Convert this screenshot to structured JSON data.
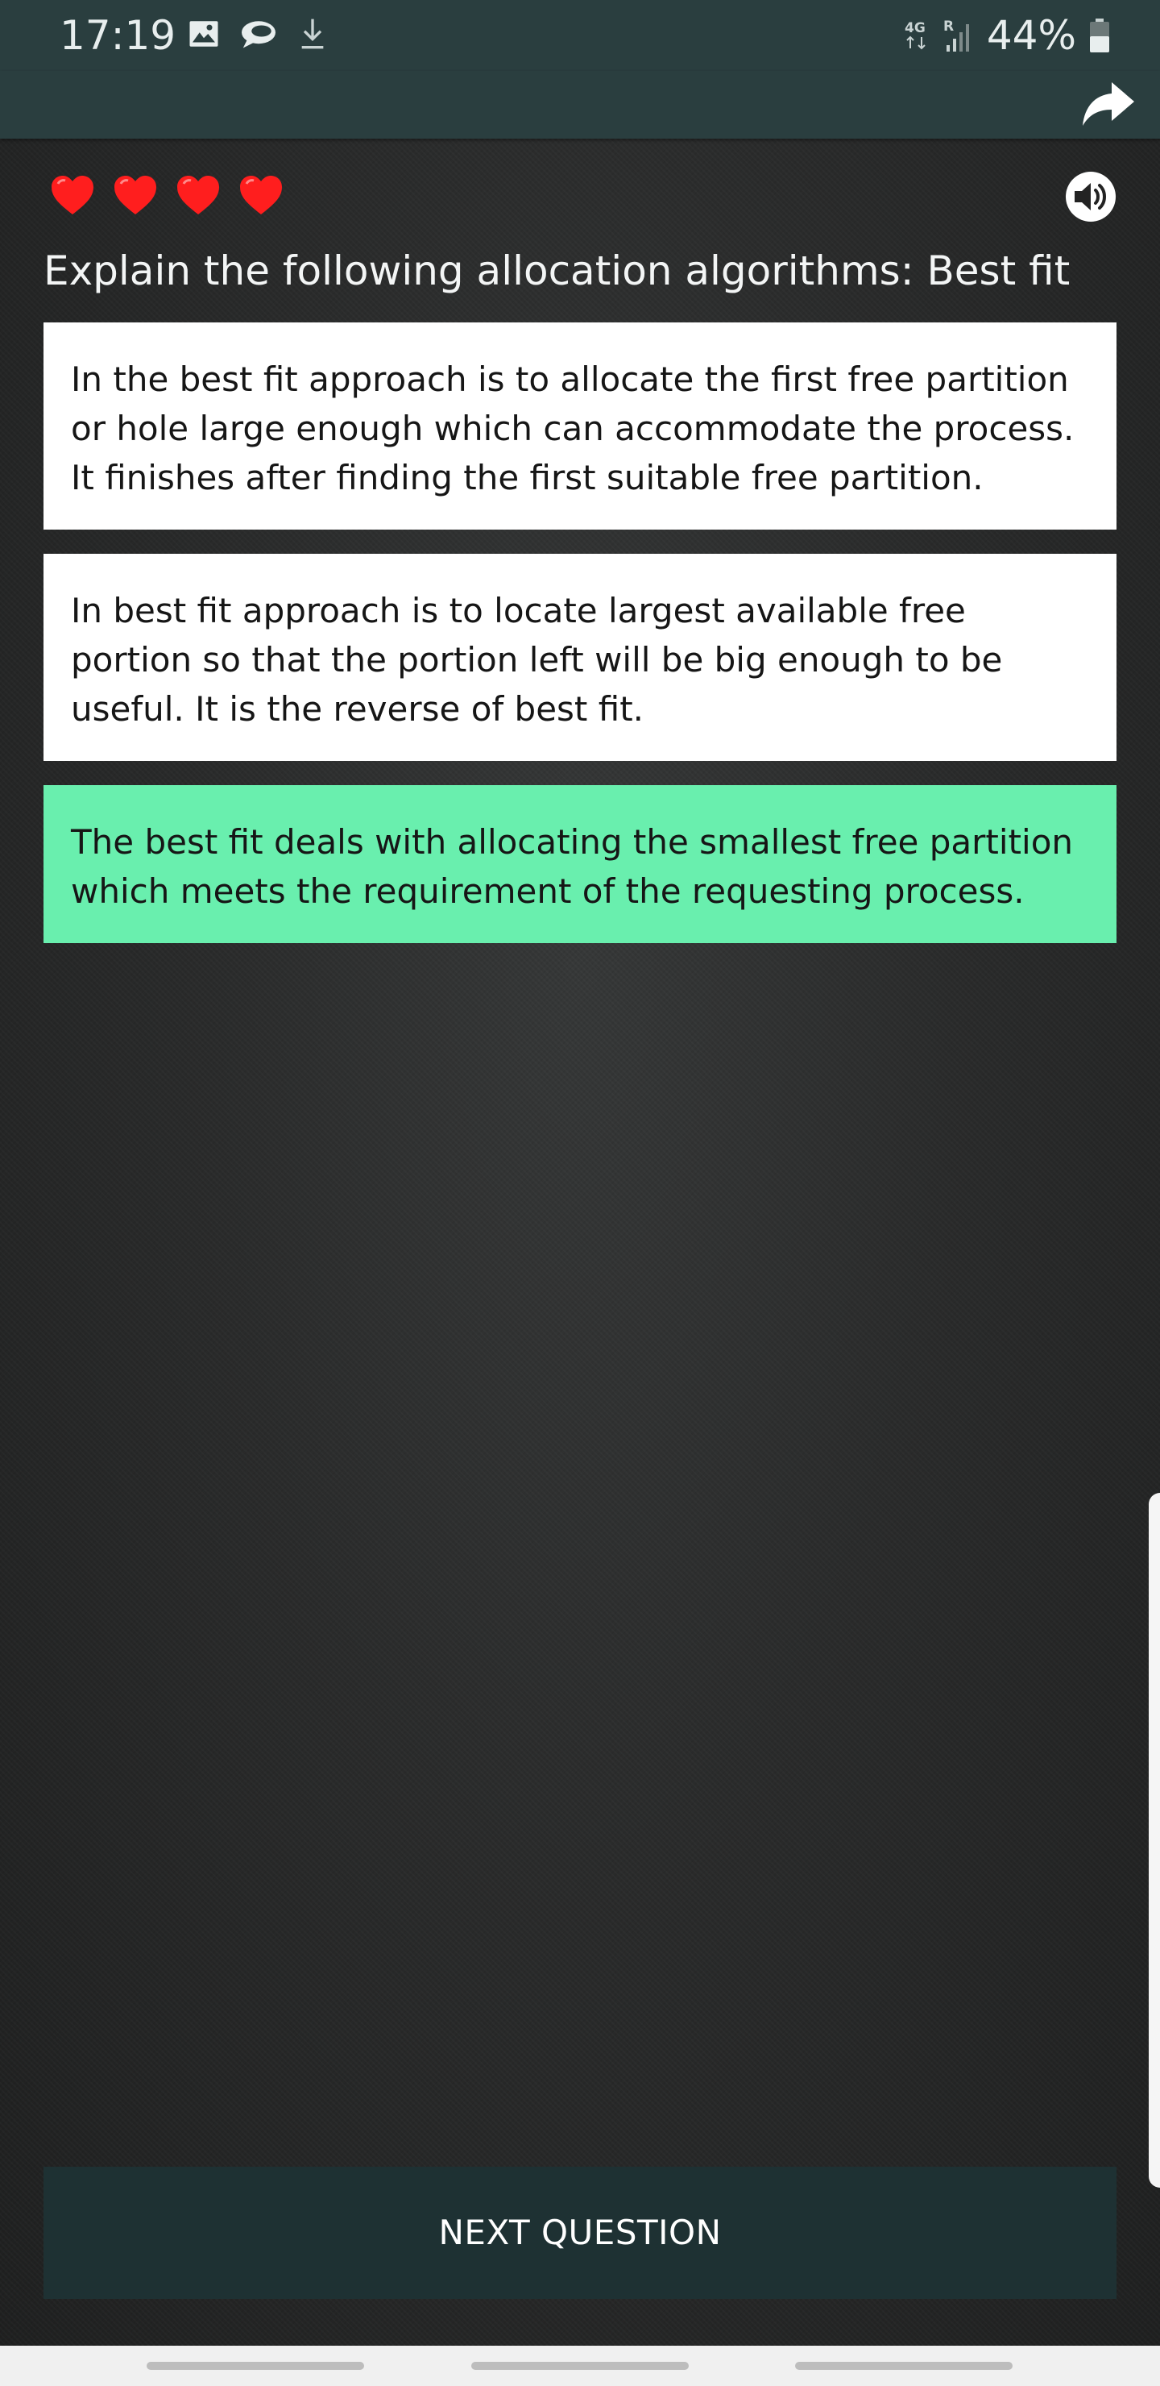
{
  "status_bar": {
    "time": "17:19",
    "left_icons": [
      "image-icon",
      "chat-bubble-icon",
      "download-icon"
    ],
    "network": "4G",
    "roaming": "R",
    "battery": "44%"
  },
  "app_bar": {
    "share_icon": "share-arrow-icon"
  },
  "lives": {
    "count": 4,
    "icon": "heart-icon",
    "color": "#ff1e1e"
  },
  "sound_icon": "speaker-icon",
  "question": "Explain the following allocation algorithms: Best fit",
  "answers": [
    {
      "text": "In the best fit approach is to allocate the first free partition or hole large enough which can accommodate the process. It finishes after finding the first suitable free partition.",
      "state": "default"
    },
    {
      "text": "In best fit approach is to locate largest available free portion so that the portion left will be big enough to be useful. It is the reverse of best fit.",
      "state": "default"
    },
    {
      "text": "The best fit deals with allocating the smallest free partition which meets the requirement of the requesting process.",
      "state": "correct"
    }
  ],
  "next_button": "NEXT QUESTION",
  "colors": {
    "app_bar": "#2a3e3f",
    "correct_answer": "#69efae",
    "next_button": "#1e3133"
  }
}
